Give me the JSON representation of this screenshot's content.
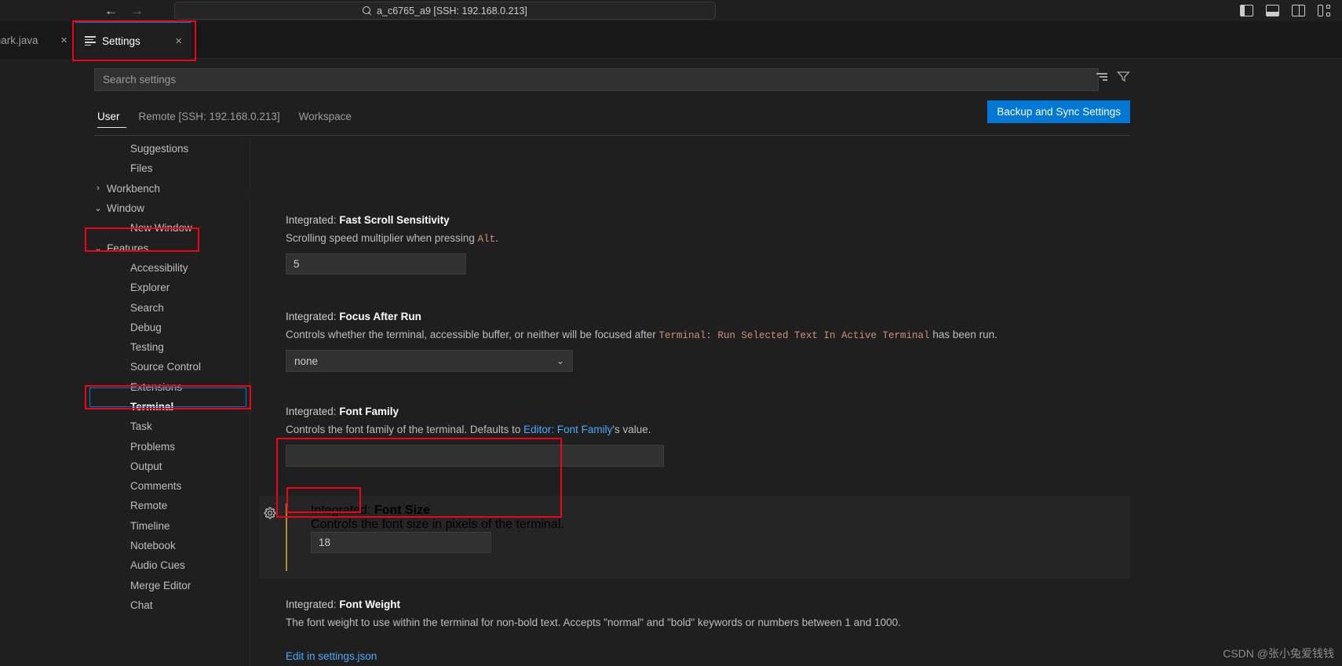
{
  "titlebar": {
    "back_icon": "arrow-left-icon",
    "forward_icon": "arrow-right-icon",
    "quick_input": "a_c6765_a9 [SSH: 192.168.0.213]",
    "layout_icons": [
      "toggle-primary-sidebar-icon",
      "toggle-panel-icon",
      "toggle-secondary-sidebar-icon",
      "customize-layout-icon"
    ]
  },
  "tabs": [
    {
      "label": "mark.java",
      "close": "×",
      "active": false
    },
    {
      "label": "Settings",
      "close": "×",
      "active": true
    }
  ],
  "search": {
    "placeholder": "Search settings",
    "value": "",
    "clear_icon": "clear-settings-search-icon",
    "filter_icon": "filter-settings-icon"
  },
  "scope_tabs": [
    {
      "label": "User",
      "active": true
    },
    {
      "label": "Remote [SSH: 192.168.0.213]",
      "active": false
    },
    {
      "label": "Workspace",
      "active": false
    }
  ],
  "backup_button": {
    "label": "Backup and Sync Settings",
    "color": "#0078d4"
  },
  "toc": [
    {
      "label": "Suggestions",
      "level": 2,
      "chev": "",
      "selected": false,
      "clipped": true
    },
    {
      "label": "Files",
      "level": 2,
      "chev": "",
      "selected": false
    },
    {
      "label": "Workbench",
      "level": 1,
      "chev": "›",
      "selected": false
    },
    {
      "label": "Window",
      "level": 1,
      "chev": "⌄",
      "selected": false
    },
    {
      "label": "New Window",
      "level": 2,
      "chev": "",
      "selected": false
    },
    {
      "label": "Features",
      "level": 1,
      "chev": "⌄",
      "selected": false,
      "annotated": true
    },
    {
      "label": "Accessibility",
      "level": 2,
      "chev": "",
      "selected": false
    },
    {
      "label": "Explorer",
      "level": 2,
      "chev": "",
      "selected": false
    },
    {
      "label": "Search",
      "level": 2,
      "chev": "",
      "selected": false
    },
    {
      "label": "Debug",
      "level": 2,
      "chev": "",
      "selected": false
    },
    {
      "label": "Testing",
      "level": 2,
      "chev": "",
      "selected": false
    },
    {
      "label": "Source Control",
      "level": 2,
      "chev": "",
      "selected": false
    },
    {
      "label": "Extensions",
      "level": 2,
      "chev": "",
      "selected": false
    },
    {
      "label": "Terminal",
      "level": 2,
      "chev": "",
      "selected": true,
      "annotated": true
    },
    {
      "label": "Task",
      "level": 2,
      "chev": "",
      "selected": false
    },
    {
      "label": "Problems",
      "level": 2,
      "chev": "",
      "selected": false
    },
    {
      "label": "Output",
      "level": 2,
      "chev": "",
      "selected": false
    },
    {
      "label": "Comments",
      "level": 2,
      "chev": "",
      "selected": false
    },
    {
      "label": "Remote",
      "level": 2,
      "chev": "",
      "selected": false
    },
    {
      "label": "Timeline",
      "level": 2,
      "chev": "",
      "selected": false
    },
    {
      "label": "Notebook",
      "level": 2,
      "chev": "",
      "selected": false
    },
    {
      "label": "Audio Cues",
      "level": 2,
      "chev": "",
      "selected": false
    },
    {
      "label": "Merge Editor",
      "level": 2,
      "chev": "",
      "selected": false
    },
    {
      "label": "Chat",
      "level": 2,
      "chev": "",
      "selected": false
    }
  ],
  "settings": {
    "fast_scroll": {
      "prefix": "Integrated: ",
      "name": "Fast Scroll Sensitivity",
      "desc_a": "Scrolling speed multiplier when pressing ",
      "desc_code": "Alt",
      "desc_b": ".",
      "value": "5"
    },
    "focus_after_run": {
      "prefix": "Integrated: ",
      "name": "Focus After Run",
      "desc_a": "Controls whether the terminal, accessible buffer, or neither will be focused after ",
      "desc_code": "Terminal: Run Selected Text In Active Terminal",
      "desc_b": " has been run.",
      "value": "none",
      "chevron": "⌄"
    },
    "font_family": {
      "prefix": "Integrated: ",
      "name": "Font Family",
      "desc_a": "Controls the font family of the terminal. Defaults to ",
      "desc_link": "Editor: Font Family",
      "desc_b": "'s value.",
      "value": ""
    },
    "font_size": {
      "prefix": "Integrated: ",
      "name": "Font Size",
      "desc": "Controls the font size in pixels of the terminal.",
      "value": "18",
      "gear_icon": "settings-gear-icon",
      "modified": true
    },
    "font_weight": {
      "prefix": "Integrated: ",
      "name": "Font Weight",
      "desc": "The font weight to use within the terminal for non-bold text. Accepts \"normal\" and \"bold\" keywords or numbers between 1 and 1000.",
      "edit_link": "Edit in settings.json"
    }
  },
  "watermark": "CSDN @张小兔爱钱钱"
}
